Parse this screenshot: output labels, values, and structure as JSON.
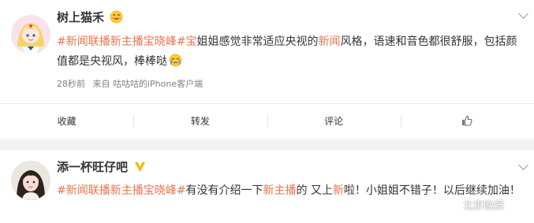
{
  "post1": {
    "username": "树上猫禾",
    "content": {
      "tag": "#新闻联播新主播宝晓峰#",
      "kw_bao": "宝",
      "text1": "姐姐感觉非常适应央视的",
      "kw_news": "新闻",
      "text2": "风格，语速和音色都很舒服，包括颜值都是央视风，棒棒哒"
    },
    "time": "28秒前",
    "source": "来自 咕咕咕的iPhone客户端"
  },
  "actions": {
    "collect": "收藏",
    "forward": "转发",
    "comment": "评论"
  },
  "post2": {
    "username": "添一杯旺仔吧",
    "content": {
      "tag": "#新闻联播新主播宝晓峰#",
      "text1": "有没有介绍一下",
      "kw_anchor": "新主播",
      "text2": "的 又上",
      "kw_new": "新",
      "text3": "啦！小姐姐不错子！以后继续加油！"
    }
  },
  "watermark": "北京晚报",
  "colors": {
    "accent": "#eb7350",
    "text": "#333333",
    "meta": "#808080",
    "verified": "#f7b500"
  },
  "icons": [
    "smile-emoji-icon",
    "cry-emoji-icon",
    "like-icon",
    "verified-badge-icon",
    "chevron-down-icon",
    "wechat-icon"
  ]
}
